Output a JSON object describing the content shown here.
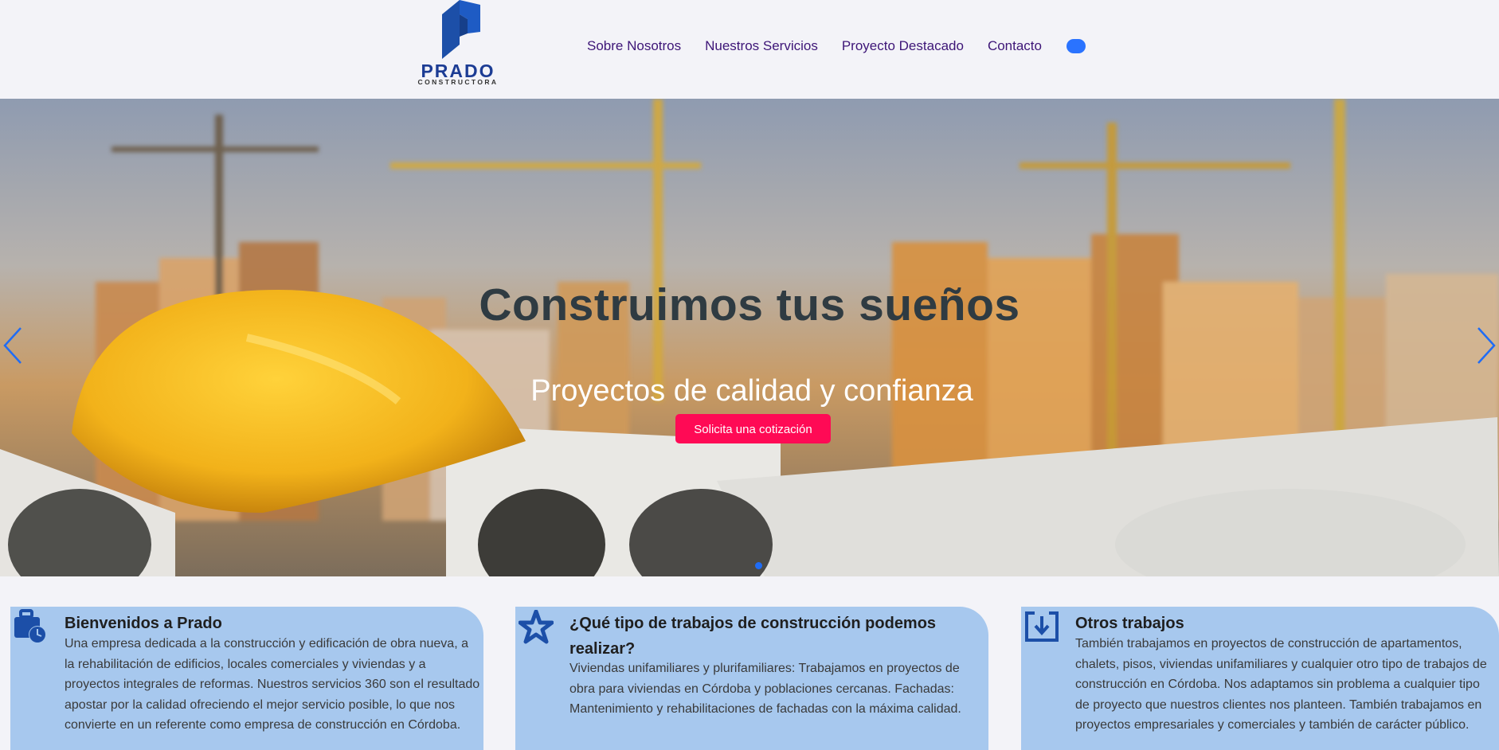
{
  "brand": {
    "name": "PRADO",
    "sub": "CONSTRUCTORA",
    "color": "#1c3c94"
  },
  "nav": {
    "items": [
      {
        "label": "Sobre Nosotros"
      },
      {
        "label": "Nuestros Servicios"
      },
      {
        "label": "Proyecto Destacado"
      },
      {
        "label": "Contacto"
      }
    ]
  },
  "hero": {
    "title": "Construimos tus sueños",
    "subtitle": "Proyectos de calidad y confianza",
    "button": "Solicita una cotización",
    "slide_count": 1,
    "active_slide": 1
  },
  "cards": [
    {
      "icon": "briefcase-clock-icon",
      "title": "Bienvenidos a Prado",
      "text": "Una empresa dedicada a la construcción y edificación de obra nueva, a la rehabilitación de edificios, locales comerciales y viviendas y a proyectos integrales de reformas. Nuestros servicios 360 son el resultado apostar por la calidad ofreciendo el mejor servicio posible, lo que nos convierte en un referente como empresa de construcción en Córdoba."
    },
    {
      "icon": "star-icon",
      "title": "¿Qué tipo de trabajos de construcción podemos realizar?",
      "text": "Viviendas unifamiliares y plurifamiliares: Trabajamos en proyectos de obra para viviendas en Córdoba y poblaciones cercanas. Fachadas: Mantenimiento y rehabilitaciones de fachadas con la máxima calidad."
    },
    {
      "icon": "download-box-icon",
      "title": "Otros trabajos",
      "text": "También trabajamos en proyectos de construcción de apartamentos, chalets, pisos, viviendas unifamiliares y cualquier otro tipo de trabajos de construcción en Córdoba. Nos adaptamos sin problema a cualquier tipo de proyecto que nuestros clientes nos planteen. También trabajamos en proyectos empresariales y comerciales y también de carácter público."
    }
  ],
  "colors": {
    "accent": "#2a73ff",
    "nav_text": "#3d1577",
    "cta": "#ff0a55",
    "card_bg": "#a7c8ee",
    "icon": "#1c4fa8"
  }
}
